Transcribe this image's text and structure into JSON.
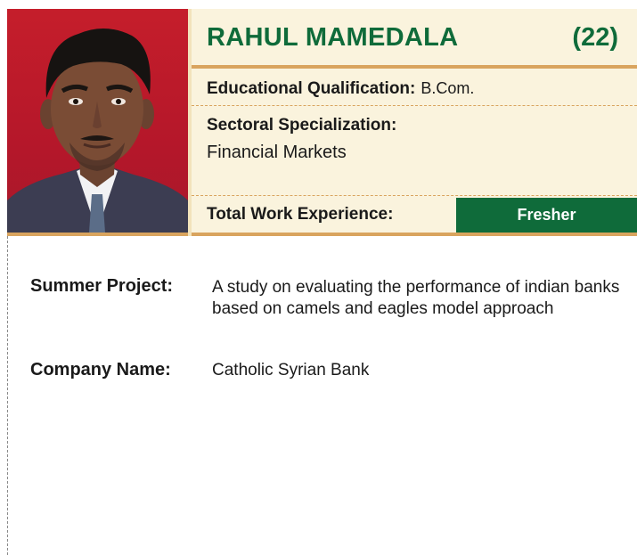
{
  "profile": {
    "name": "RAHUL MAMEDALA",
    "age": "(22)",
    "education_label": "Educational Qualification:",
    "education_value": "B.Com.",
    "sector_label": "Sectoral Specialization:",
    "sector_value": "Financial Markets",
    "experience_label": "Total Work Experience:",
    "experience_value": "Fresher",
    "summer_project_label": "Summer Project:",
    "summer_project_value": "A study on evaluating the performance of indian banks based on camels and eagles model approach",
    "company_label": "Company Name:",
    "company_value": "Catholic Syrian Bank"
  },
  "colors": {
    "brand_green": "#0f6b3a",
    "gold": "#d9a45e",
    "band_bg": "#faf3dd",
    "photo_bg": "#c51e2b"
  }
}
